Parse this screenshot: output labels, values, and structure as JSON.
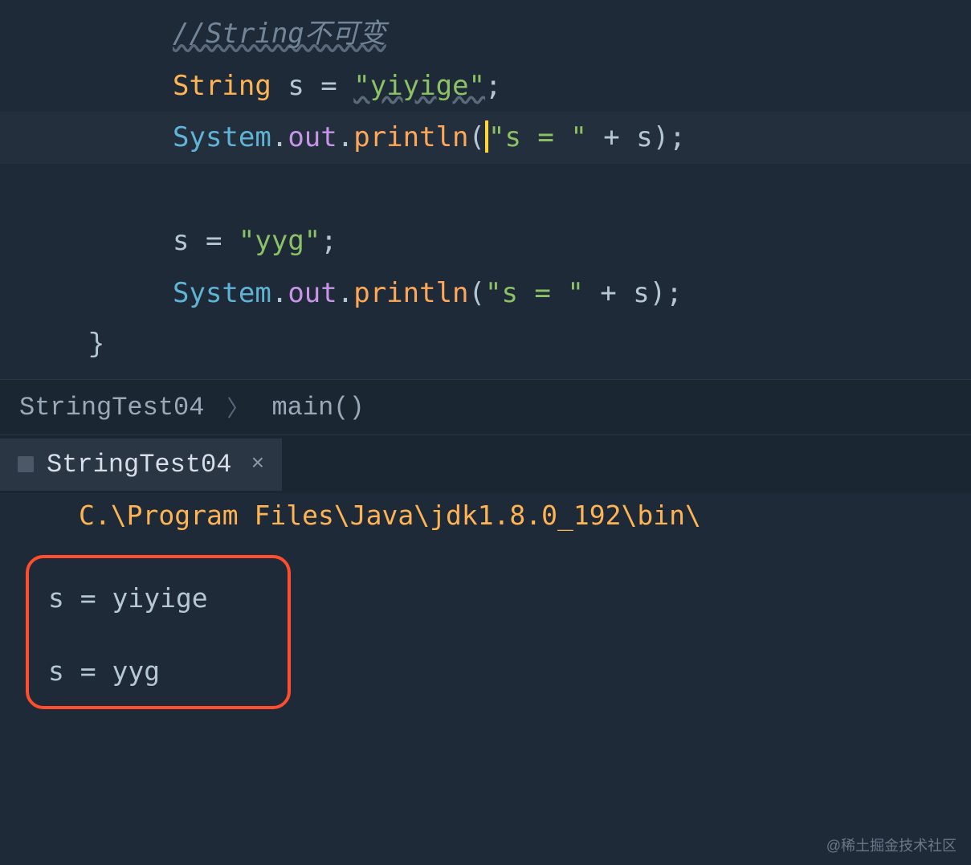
{
  "code": {
    "comment": "//String不可变",
    "line2": {
      "type": "String",
      "var": "s",
      "eq": "=",
      "str": "\"yiyige\"",
      "semi": ";"
    },
    "line3": {
      "sys": "System",
      "dot1": ".",
      "out": "out",
      "dot2": ".",
      "println": "println",
      "open": "(",
      "str": "\"s = \"",
      "plus": " + ",
      "var": "s",
      "close": ")",
      "semi": ";"
    },
    "line5": {
      "var": "s",
      "eq": " = ",
      "str": "\"yyg\"",
      "semi": ";"
    },
    "line6": {
      "sys": "System",
      "dot1": ".",
      "out": "out",
      "dot2": ".",
      "println": "println",
      "open": "(",
      "str": "\"s = \"",
      "plus": " + ",
      "var": "s",
      "close": ")",
      "semi": ";"
    },
    "closeBrace": "}"
  },
  "breadcrumb": {
    "class": "StringTest04",
    "separator": "〉",
    "method": "main()"
  },
  "console": {
    "tabName": "StringTest04",
    "closeSymbol": "×",
    "path": "C.\\Program Files\\Java\\jdk1.8.0_192\\bin\\",
    "output1": "s = yiyige",
    "output2": "s = yyg"
  },
  "watermark": "@稀土掘金技术社区"
}
